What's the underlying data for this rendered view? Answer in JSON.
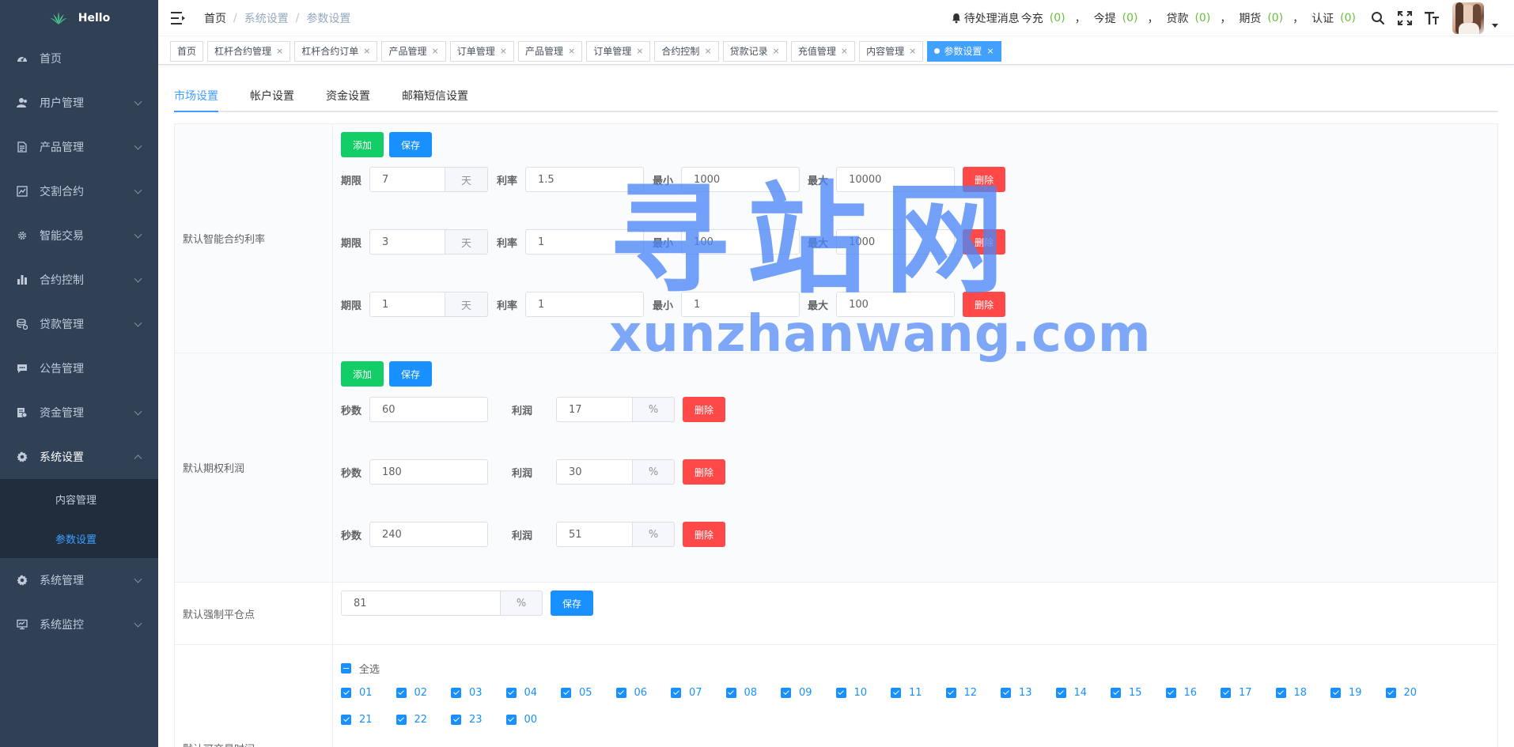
{
  "app": {
    "name": "Hello"
  },
  "sidebar": {
    "items": [
      {
        "label": "首页",
        "icon": "dashboard-icon",
        "expandable": false
      },
      {
        "label": "用户管理",
        "icon": "user-icon",
        "expandable": true
      },
      {
        "label": "产品管理",
        "icon": "document-icon",
        "expandable": true
      },
      {
        "label": "交割合约",
        "icon": "chart-icon",
        "expandable": true
      },
      {
        "label": "智能交易",
        "icon": "gear-icon",
        "expandable": true
      },
      {
        "label": "合约控制",
        "icon": "bar-chart-icon",
        "expandable": true
      },
      {
        "label": "贷款管理",
        "icon": "money-icon",
        "expandable": true
      },
      {
        "label": "公告管理",
        "icon": "message-icon",
        "expandable": false
      },
      {
        "label": "资金管理",
        "icon": "wallet-icon",
        "expandable": true
      },
      {
        "label": "系统设置",
        "icon": "settings-icon",
        "expandable": true,
        "expanded": true,
        "children": [
          {
            "label": "内容管理",
            "active": false
          },
          {
            "label": "参数设置",
            "active": true
          }
        ]
      },
      {
        "label": "系统管理",
        "icon": "settings-icon",
        "expandable": true
      },
      {
        "label": "系统监控",
        "icon": "monitor-icon",
        "expandable": true
      }
    ]
  },
  "header": {
    "breadcrumb": [
      "首页",
      "系统设置",
      "参数设置"
    ],
    "notice": {
      "label": "待处理消息",
      "items": [
        {
          "label": "今充",
          "count": "(0)"
        },
        {
          "label": "今提",
          "count": "(0)"
        },
        {
          "label": "贷款",
          "count": "(0)"
        },
        {
          "label": "期货",
          "count": "(0)"
        },
        {
          "label": "认证",
          "count": "(0)"
        }
      ],
      "separator": "，"
    }
  },
  "tags": [
    {
      "label": "首页",
      "closable": false,
      "active": false
    },
    {
      "label": "杠杆合约管理",
      "closable": true,
      "active": false
    },
    {
      "label": "杠杆合约订单",
      "closable": true,
      "active": false
    },
    {
      "label": "产品管理",
      "closable": true,
      "active": false
    },
    {
      "label": "订单管理",
      "closable": true,
      "active": false
    },
    {
      "label": "产品管理",
      "closable": true,
      "active": false
    },
    {
      "label": "订单管理",
      "closable": true,
      "active": false
    },
    {
      "label": "合约控制",
      "closable": true,
      "active": false
    },
    {
      "label": "贷款记录",
      "closable": true,
      "active": false
    },
    {
      "label": "充值管理",
      "closable": true,
      "active": false
    },
    {
      "label": "内容管理",
      "closable": true,
      "active": false
    },
    {
      "label": "参数设置",
      "closable": true,
      "active": true
    }
  ],
  "tabs": [
    {
      "label": "市场设置",
      "active": true
    },
    {
      "label": "帐户设置",
      "active": false
    },
    {
      "label": "资金设置",
      "active": false
    },
    {
      "label": "邮箱短信设置",
      "active": false
    }
  ],
  "buttons": {
    "add": "添加",
    "save": "保存",
    "delete": "删除"
  },
  "smart_contract": {
    "label": "默认智能合约利率",
    "field_labels": {
      "period": "期限",
      "unit": "天",
      "rate": "利率",
      "min": "最小",
      "max": "最大"
    },
    "rows": [
      {
        "period": "7",
        "rate": "1.5",
        "min": "1000",
        "max": "10000"
      },
      {
        "period": "3",
        "rate": "1",
        "min": "100",
        "max": "1000"
      },
      {
        "period": "1",
        "rate": "1",
        "min": "1",
        "max": "100"
      }
    ]
  },
  "option_profit": {
    "label": "默认期权利润",
    "field_labels": {
      "seconds": "秒数",
      "profit": "利润",
      "unit": "%"
    },
    "rows": [
      {
        "seconds": "60",
        "profit": "17"
      },
      {
        "seconds": "180",
        "profit": "30"
      },
      {
        "seconds": "240",
        "profit": "51"
      }
    ]
  },
  "liquidation": {
    "label": "默认强制平仓点",
    "value": "81",
    "unit": "%"
  },
  "trade_hours": {
    "label": "默认可交易时间",
    "select_all": "全选",
    "hours": [
      "01",
      "02",
      "03",
      "04",
      "05",
      "06",
      "07",
      "08",
      "09",
      "10",
      "11",
      "12",
      "13",
      "14",
      "15",
      "16",
      "17",
      "18",
      "19",
      "20",
      "21",
      "22",
      "23",
      "00"
    ]
  },
  "watermark": {
    "cn": "寻站网",
    "en": "xunzhanwang.com"
  },
  "colors": {
    "sidebar_bg": "#304156",
    "primary": "#1890ff",
    "success": "#13ce66",
    "danger": "#ff4949",
    "count": "#67c23a"
  }
}
